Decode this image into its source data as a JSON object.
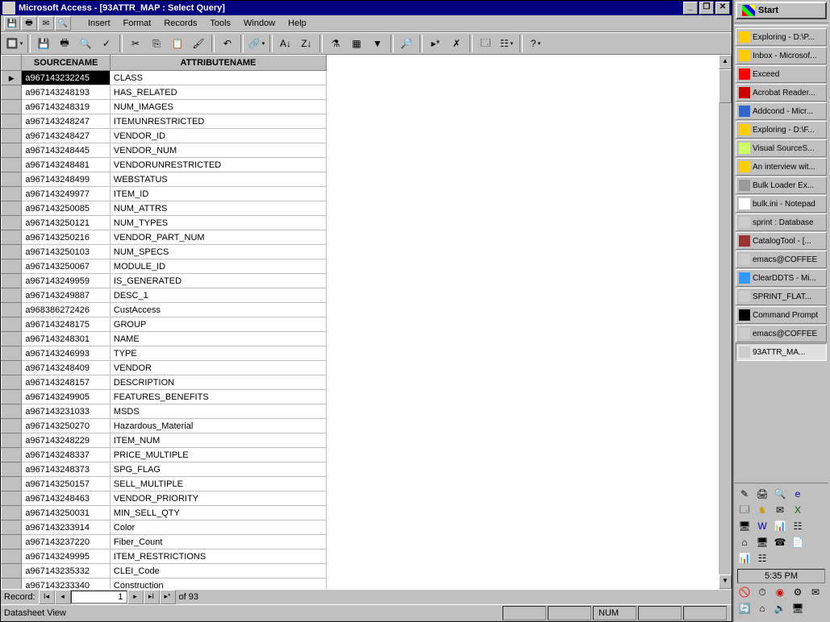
{
  "title": "Microsoft Access - [93ATTR_MAP : Select Query]",
  "menus": [
    "Insert",
    "Format",
    "Records",
    "Tools",
    "Window",
    "Help"
  ],
  "columns": [
    "SOURCENAME",
    "ATTRIBUTENAME"
  ],
  "rows": [
    {
      "s": "a967143232245",
      "a": "CLASS"
    },
    {
      "s": "a967143248193",
      "a": "HAS_RELATED"
    },
    {
      "s": "a967143248319",
      "a": "NUM_IMAGES"
    },
    {
      "s": "a967143248247",
      "a": "ITEMUNRESTRICTED"
    },
    {
      "s": "a967143248427",
      "a": "VENDOR_ID"
    },
    {
      "s": "a967143248445",
      "a": "VENDOR_NUM"
    },
    {
      "s": "a967143248481",
      "a": "VENDORUNRESTRICTED"
    },
    {
      "s": "a967143248499",
      "a": "WEBSTATUS"
    },
    {
      "s": "a967143249977",
      "a": "ITEM_ID"
    },
    {
      "s": "a967143250085",
      "a": "NUM_ATTRS"
    },
    {
      "s": "a967143250121",
      "a": "NUM_TYPES"
    },
    {
      "s": "a967143250216",
      "a": "VENDOR_PART_NUM"
    },
    {
      "s": "a967143250103",
      "a": "NUM_SPECS"
    },
    {
      "s": "a967143250067",
      "a": "MODULE_ID"
    },
    {
      "s": "a967143249959",
      "a": "IS_GENERATED"
    },
    {
      "s": "a967143249887",
      "a": "DESC_1"
    },
    {
      "s": "a968386272426",
      "a": "CustAccess"
    },
    {
      "s": "a967143248175",
      "a": "GROUP"
    },
    {
      "s": "a967143248301",
      "a": "NAME"
    },
    {
      "s": "a967143246993",
      "a": "TYPE"
    },
    {
      "s": "a967143248409",
      "a": "VENDOR"
    },
    {
      "s": "a967143248157",
      "a": "DESCRIPTION"
    },
    {
      "s": "a967143249905",
      "a": "FEATURES_BENEFITS"
    },
    {
      "s": "a967143231033",
      "a": "MSDS"
    },
    {
      "s": "a967143250270",
      "a": "Hazardous_Material"
    },
    {
      "s": "a967143248229",
      "a": "ITEM_NUM"
    },
    {
      "s": "a967143248337",
      "a": "PRICE_MULTIPLE"
    },
    {
      "s": "a967143248373",
      "a": "SPG_FLAG"
    },
    {
      "s": "a967143250157",
      "a": "SELL_MULTIPLE"
    },
    {
      "s": "a967143248463",
      "a": "VENDOR_PRIORITY"
    },
    {
      "s": "a967143250031",
      "a": "MIN_SELL_QTY"
    },
    {
      "s": "a967143233914",
      "a": "Color"
    },
    {
      "s": "a967143237220",
      "a": "Fiber_Count"
    },
    {
      "s": "a967143249995",
      "a": "ITEM_RESTRICTIONS"
    },
    {
      "s": "a967143235332",
      "a": "CLEI_Code"
    },
    {
      "s": "a967143233340",
      "a": "Construction"
    }
  ],
  "record": {
    "label": "Record:",
    "current": "1",
    "of": "of  93"
  },
  "status": {
    "view": "Datasheet View",
    "num": "NUM"
  },
  "start": "Start",
  "tasks": [
    {
      "t": "Exploring - D:\\P...",
      "c": "#ffcc00"
    },
    {
      "t": "Inbox - Microsof...",
      "c": "#ffcc00"
    },
    {
      "t": "Exceed",
      "c": "#ff0000"
    },
    {
      "t": "Acrobat Reader...",
      "c": "#cc0000"
    },
    {
      "t": "Addcond - Micr...",
      "c": "#3366cc"
    },
    {
      "t": "Exploring - D:\\F...",
      "c": "#ffcc00"
    },
    {
      "t": "Visual SourceS...",
      "c": "#ccff66"
    },
    {
      "t": "An interview wit...",
      "c": "#ffcc00"
    },
    {
      "t": "Bulk Loader Ex...",
      "c": "#999999"
    },
    {
      "t": "bulk.ini - Notepad",
      "c": "#ffffff"
    },
    {
      "t": "sprint : Database",
      "c": "#cccccc"
    },
    {
      "t": "CatalogTool - [...",
      "c": "#993333"
    },
    {
      "t": "emacs@COFFEE",
      "c": "#cccccc"
    },
    {
      "t": "ClearDDTS - Mi...",
      "c": "#3399ff"
    },
    {
      "t": "SPRINT_FLAT...",
      "c": "#cccccc"
    },
    {
      "t": "Command Prompt",
      "c": "#000000"
    },
    {
      "t": "emacs@COFFEE",
      "c": "#cccccc"
    },
    {
      "t": "93ATTR_MA...",
      "c": "#cccccc",
      "active": true
    }
  ],
  "clock": "5:35 PM"
}
